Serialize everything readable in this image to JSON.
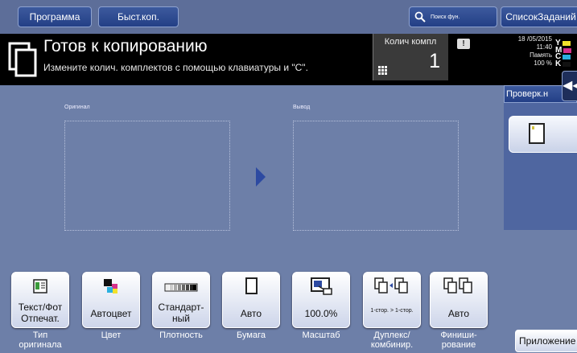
{
  "topbar": {
    "program_label": "Программа",
    "fast_copy_label": "Быст.коп.",
    "search_label": "Поиск фун.",
    "job_list_label": "СписокЗаданий"
  },
  "header": {
    "title": "Готов к копированию",
    "subtitle": "Измените колич. комплектов с помощью клавиатуры и \"C\".",
    "sets_label": "Колич компл",
    "sets_value": "1",
    "warning_symbol": "!",
    "status": {
      "date": "18 /05/2015",
      "time": "11:40",
      "memory_label": "Память",
      "memory_value": "100 %"
    },
    "toner": [
      {
        "letter": "Y",
        "color": "#f2e12b"
      },
      {
        "letter": "M",
        "color": "#d6318c"
      },
      {
        "letter": "C",
        "color": "#2bb0e0"
      },
      {
        "letter": "K",
        "color": "#111111"
      }
    ]
  },
  "main": {
    "original_label": "Оригинал",
    "output_label": "Вывод"
  },
  "right": {
    "check_label": "Проверк.н",
    "collapse_symbol": "◀◀"
  },
  "functions": [
    {
      "name": "original-type",
      "value": "Текст/Фот Отпечат.",
      "label": "Тип оригинала",
      "icon": "text-photo-icon"
    },
    {
      "name": "color",
      "value": "Автоцвет",
      "label": "Цвет",
      "icon": "auto-color-icon"
    },
    {
      "name": "density",
      "value": "Стандарт-ный",
      "label": "Плотность",
      "icon": "density-icon"
    },
    {
      "name": "paper",
      "value": "Авто",
      "label": "Бумага",
      "icon": "paper-icon"
    },
    {
      "name": "zoom",
      "value": "100.0%",
      "label": "Масштаб",
      "icon": "zoom-icon"
    },
    {
      "name": "duplex",
      "value": "1-стор. > 1-стор.",
      "label": "Дуплекс/ комбинир.",
      "icon": "duplex-icon"
    },
    {
      "name": "finishing",
      "value": "Авто",
      "label": "Финиши-рование",
      "icon": "finishing-icon"
    }
  ],
  "apps_label": "Приложение",
  "colors": {
    "background": "#6d7fa8",
    "header": "#000000",
    "button_blue": "#233f86",
    "arrow": "#2d4aa1"
  }
}
